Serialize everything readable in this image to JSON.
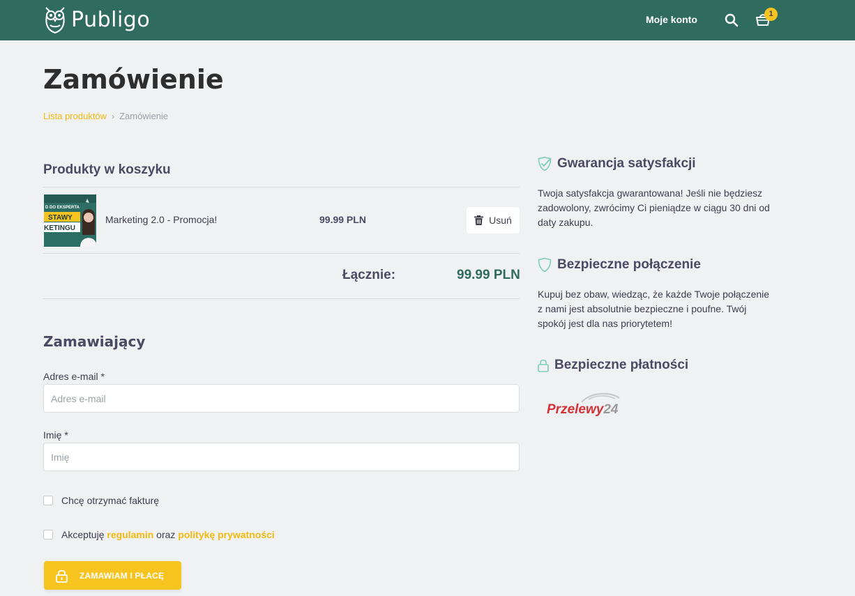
{
  "header": {
    "logo_text": "Publigo",
    "account_link": "Moje konto",
    "cart_count": "1"
  },
  "page": {
    "title": "Zamówienie",
    "breadcrumb": {
      "link": "Lista produktów",
      "current": "Zamówienie"
    }
  },
  "cart": {
    "heading": "Produkty w koszyku",
    "items": [
      {
        "name": "Marketing 2.0 - Promocja!",
        "price": "99.99 PLN",
        "remove_label": "Usuń",
        "thumb_lines": [
          "D DO EKSPERTA",
          "STAWY",
          "KETINGU"
        ]
      }
    ],
    "total_label": "Łącznie:",
    "total_value": "99.99 PLN"
  },
  "form": {
    "heading": "Zamawiający",
    "email_label": "Adres e-mail *",
    "email_placeholder": "Adres e-mail",
    "email_value": "",
    "name_label": "Imię *",
    "name_placeholder": "Imię",
    "name_value": "",
    "invoice_label": "Chcę otrzymać fakturę",
    "terms_prefix": "Akceptuję",
    "terms_link": "regulamin",
    "terms_middle": "oraz",
    "privacy_link": "politykę prywatności",
    "submit_label": "ZAMAWIAM I PŁACĘ"
  },
  "sidebar": {
    "guarantee": {
      "title": "Gwarancja satysfakcji",
      "text": "Twoja satysfakcja gwarantowana! Jeśli nie będziesz zadowolony, zwrócimy Ci pieniądze w ciągu 30 dni od daty zakupu.",
      "icon": "check-shield-icon"
    },
    "secure_connection": {
      "title": "Bezpieczne połączenie",
      "text": "Kupuj bez obaw, wiedząc, że każde Twoje połączenie z nami jest absolutnie bezpieczne i poufne. Twój spokój jest dla nas priorytetem!",
      "icon": "shield-icon"
    },
    "secure_payments": {
      "title": "Bezpieczne płatności",
      "icon": "lock-icon",
      "provider_logo": "Przelewy24"
    }
  },
  "colors": {
    "header_bg": "#2f6b5f",
    "accent": "#f6c31f",
    "link": "#f2b90f",
    "total": "#2f6b5f",
    "page_bg": "#f0f1f2"
  }
}
